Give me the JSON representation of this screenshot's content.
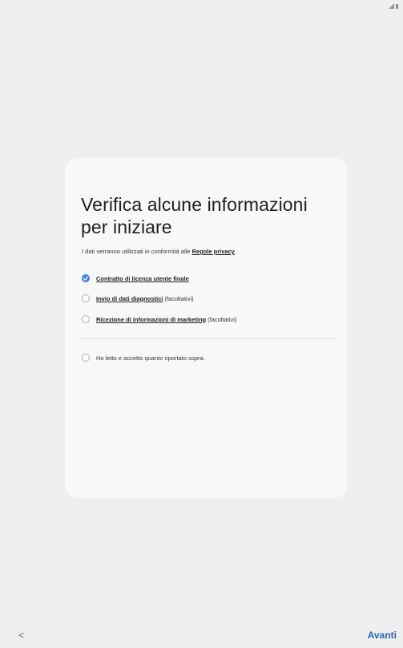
{
  "card": {
    "title": "Verifica alcune informazioni per iniziare",
    "subtitle_prefix": "I dati verranno utilizzati in conformità alle",
    "privacy_link": "Regole privacy",
    "subtitle_suffix": "."
  },
  "options": [
    {
      "link": "Contratto di licenza utente finale",
      "extra": "",
      "checked": true
    },
    {
      "link": "Invio di dati diagnostici",
      "extra": "(facoltativi)",
      "checked": false
    },
    {
      "link": "Ricezione di informazioni di marketing",
      "extra": "(facoltativi)",
      "checked": false
    }
  ],
  "accept_all": {
    "label": "Ho letto e accetto quanto riportato sopra.",
    "checked": false
  },
  "footer": {
    "back": "<",
    "next": "Avanti"
  },
  "colors": {
    "accent": "#3f84e3",
    "next_text": "#2a66b8",
    "background": "#efefef",
    "card": "#f8f8f8"
  }
}
